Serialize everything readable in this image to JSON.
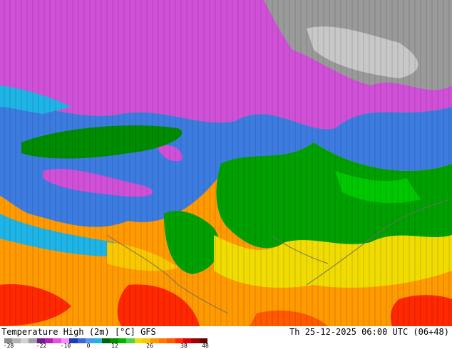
{
  "map": {
    "title": "Temperature High (2m) [°C] GFS",
    "datetime": "Th 25-12-2025 06:00 UTC (06+48)"
  },
  "legend": {
    "ticks": [
      "-28",
      "-22",
      "-10",
      "0",
      "12",
      "26",
      "38",
      "48"
    ],
    "colors": [
      "#8c8c8c",
      "#b4b4b4",
      "#d2d2d2",
      "#a0a0a0",
      "#6e1e8c",
      "#b41eb4",
      "#e650e6",
      "#ff8cff",
      "#1e3cb4",
      "#3c64dc",
      "#5096f0",
      "#1eb4e6",
      "#006400",
      "#008c00",
      "#00b400",
      "#50d250",
      "#f0dc00",
      "#fac800",
      "#ff9600",
      "#ff7800",
      "#ff5a00",
      "#ff2800",
      "#dc0000",
      "#a00000",
      "#640000"
    ],
    "colorscale_note": ""
  }
}
